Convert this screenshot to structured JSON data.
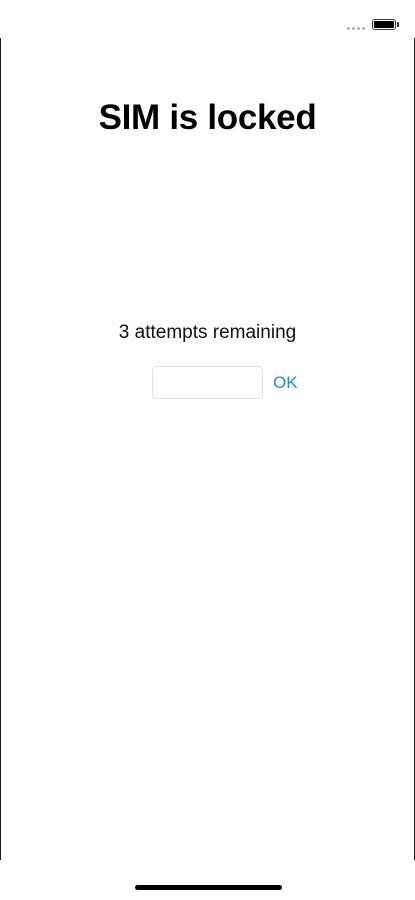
{
  "title": "SIM is locked",
  "attempts_text": "3 attempts remaining",
  "pin_field": {
    "value": "",
    "placeholder": ""
  },
  "ok_button_label": "OK",
  "colors": {
    "accent": "#1a8fd1",
    "background": "#ffffff",
    "text": "#000000"
  },
  "status_bar": {
    "signal_icon": "cellular-signal-icon",
    "battery_icon": "battery-icon"
  }
}
